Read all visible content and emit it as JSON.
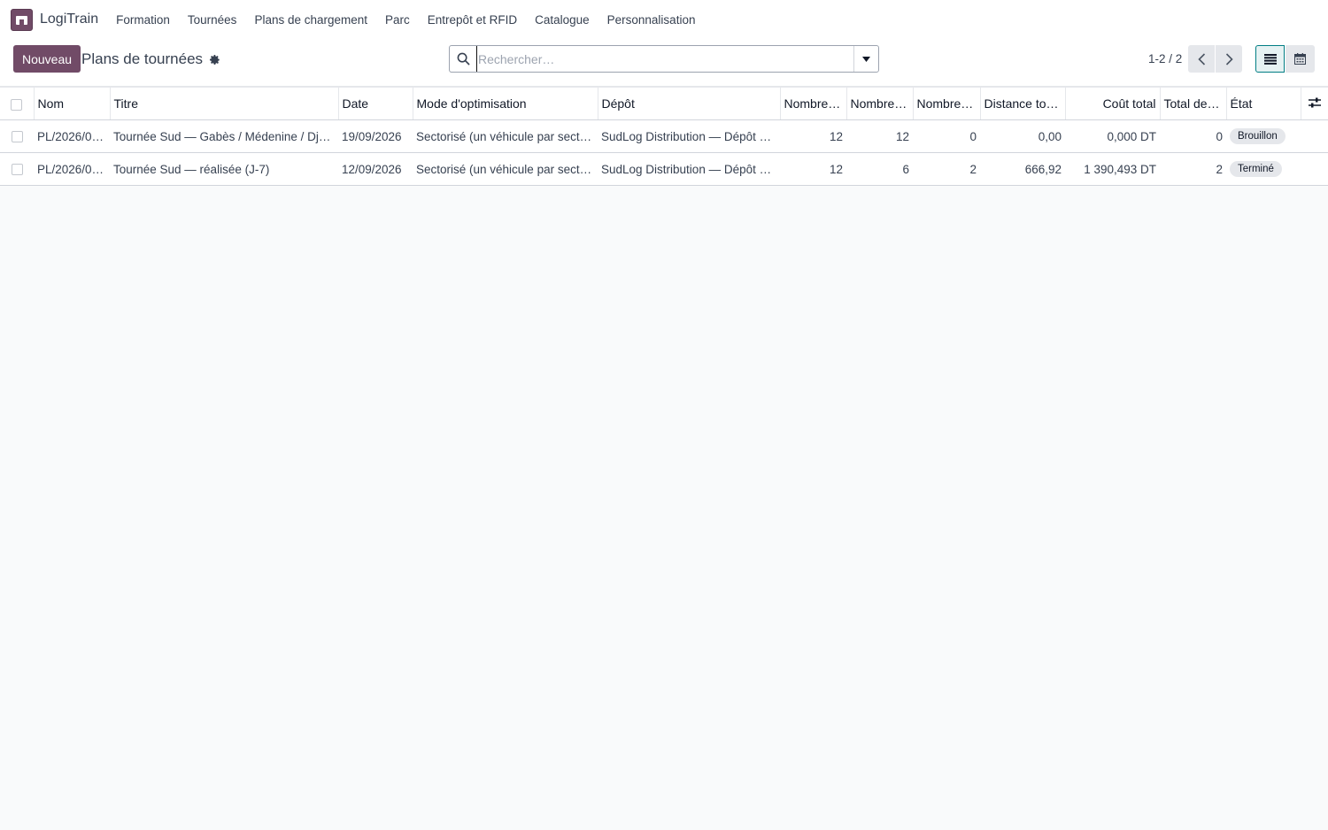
{
  "navbar": {
    "app_name": "LogiTrain",
    "menu": [
      "Formation",
      "Tournées",
      "Plans de chargement",
      "Parc",
      "Entrepôt et RFID",
      "Catalogue",
      "Personnalisation"
    ]
  },
  "control_panel": {
    "new_button": "Nouveau",
    "title": "Plans de tournées",
    "search_placeholder": "Rechercher…",
    "pager": "1-2 / 2"
  },
  "table": {
    "columns": [
      "Nom",
      "Titre",
      "Date",
      "Mode d'optimisation",
      "Dépôt",
      "Nombre …",
      "Nombre …",
      "Nombre …",
      "Distance tot…",
      "Coût total",
      "Total de…",
      "État"
    ],
    "rows": [
      {
        "nom": "PL/2026/0…",
        "titre": "Tournée Sud — Gabès / Médenine / Dje…",
        "date": "19/09/2026",
        "mode": "Sectorisé (un véhicule par secte…",
        "depot": "SudLog Distribution — Dépôt S…",
        "n1": "12",
        "n2": "12",
        "n3": "0",
        "distance": "0,00",
        "cout": "0,000 DT",
        "total": "0",
        "etat": "Brouillon"
      },
      {
        "nom": "PL/2026/0…",
        "titre": "Tournée Sud — réalisée (J-7)",
        "date": "12/09/2026",
        "mode": "Sectorisé (un véhicule par secte…",
        "depot": "SudLog Distribution — Dépôt S…",
        "n1": "12",
        "n2": "6",
        "n3": "2",
        "distance": "666,92",
        "cout": "1 390,493 DT",
        "total": "2",
        "etat": "Terminé"
      }
    ]
  }
}
